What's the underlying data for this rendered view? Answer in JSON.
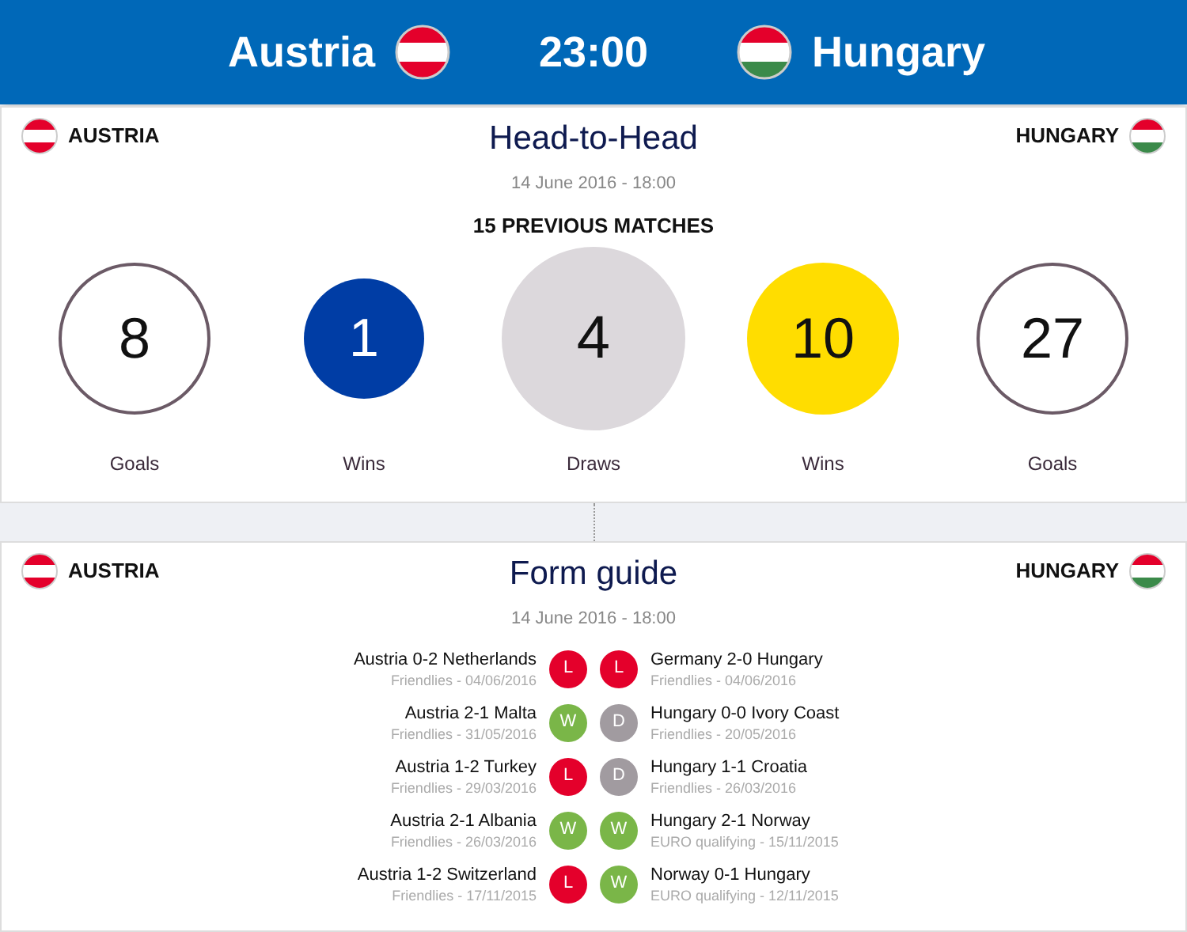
{
  "header": {
    "home": "Austria",
    "time": "23:00",
    "away": "Hungary"
  },
  "head_to_head": {
    "home": "AUSTRIA",
    "title": "Head-to-Head",
    "away": "HUNGARY",
    "date": "14 June 2016 - 18:00",
    "subtitle": "15 PREVIOUS MATCHES",
    "stats": [
      {
        "value": "8",
        "label": "Goals",
        "kind": "ring"
      },
      {
        "value": "1",
        "label": "Wins",
        "kind": "small",
        "color": "#003da5"
      },
      {
        "value": "4",
        "label": "Draws",
        "kind": "large",
        "color": "#dcd8dc"
      },
      {
        "value": "10",
        "label": "Wins",
        "kind": "disc",
        "color": "#ffdd00"
      },
      {
        "value": "27",
        "label": "Goals",
        "kind": "ring"
      }
    ]
  },
  "form_guide": {
    "home": "AUSTRIA",
    "title": "Form guide",
    "away": "HUNGARY",
    "date": "14 June 2016 - 18:00",
    "rows": [
      {
        "home_match": "Austria 0-2 Netherlands",
        "home_info": "Friendlies - 04/06/2016",
        "home_result": {
          "text": "L",
          "kind": "loss"
        },
        "away_result": {
          "text": "L",
          "kind": "loss"
        },
        "away_match": "Germany 2-0 Hungary",
        "away_info": "Friendlies - 04/06/2016"
      },
      {
        "home_match": "Austria 2-1 Malta",
        "home_info": "Friendlies - 31/05/2016",
        "home_result": {
          "text": "W",
          "kind": "win"
        },
        "away_result": {
          "text": "D",
          "kind": "draw"
        },
        "away_match": "Hungary 0-0 Ivory Coast",
        "away_info": "Friendlies - 20/05/2016"
      },
      {
        "home_match": "Austria 1-2 Turkey",
        "home_info": "Friendlies - 29/03/2016",
        "home_result": {
          "text": "L",
          "kind": "loss"
        },
        "away_result": {
          "text": "D",
          "kind": "draw"
        },
        "away_match": "Hungary 1-1 Croatia",
        "away_info": "Friendlies - 26/03/2016"
      },
      {
        "home_match": "Austria 2-1 Albania",
        "home_info": "Friendlies - 26/03/2016",
        "home_result": {
          "text": "W",
          "kind": "win"
        },
        "away_result": {
          "text": "W",
          "kind": "win"
        },
        "away_match": "Hungary 2-1 Norway",
        "away_info": "EURO qualifying - 15/11/2015"
      },
      {
        "home_match": "Austria 1-2 Switzerland",
        "home_info": "Friendlies - 17/11/2015",
        "home_result": {
          "text": "L",
          "kind": "loss"
        },
        "away_result": {
          "text": "W",
          "kind": "win"
        },
        "away_match": "Norway 0-1 Hungary",
        "away_info": "EURO qualifying - 12/11/2015"
      }
    ]
  }
}
